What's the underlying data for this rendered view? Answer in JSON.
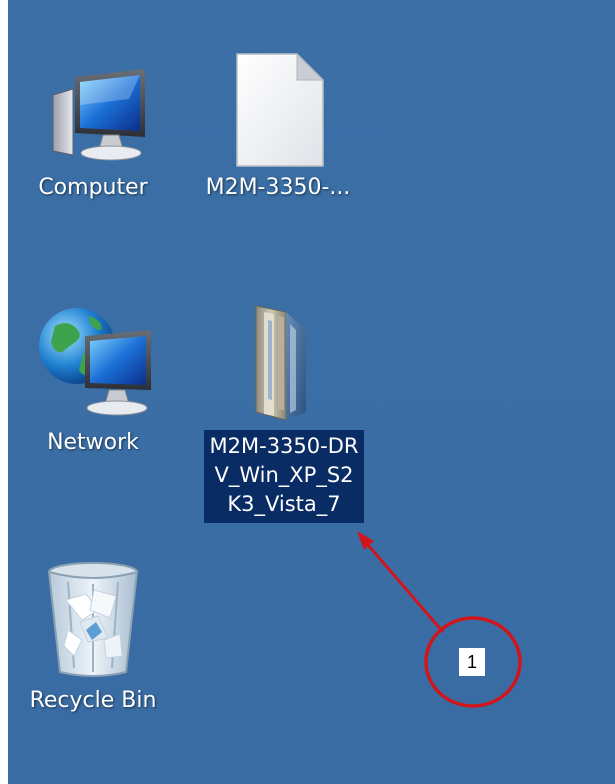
{
  "desktop": {
    "icons": [
      {
        "id": "computer",
        "label": "Computer",
        "icon": "computer-icon"
      },
      {
        "id": "file",
        "label": "M2M-3350-...",
        "icon": "file-icon"
      },
      {
        "id": "network",
        "label": "Network",
        "icon": "network-icon"
      },
      {
        "id": "folder",
        "label": "M2M-3350-DRV_Win_XP_S2K3_Vista_7",
        "icon": "folder-icon",
        "selected": true
      },
      {
        "id": "recycle",
        "label": "Recycle Bin",
        "icon": "recycle-bin-icon"
      }
    ]
  },
  "annotation": {
    "callout_number": "1",
    "color": "#d0161c"
  },
  "colors": {
    "desktop_background": "#3a6ea5",
    "selection_background": "#0a2c64"
  }
}
